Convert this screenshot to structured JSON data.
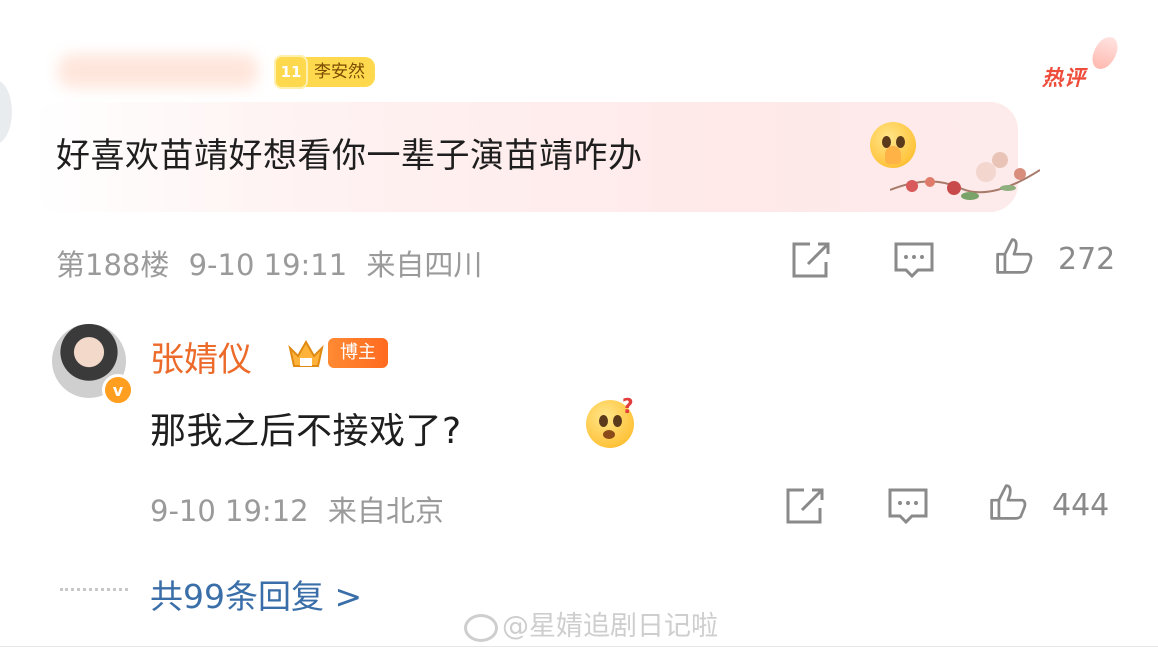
{
  "comment": {
    "fan_level": "11",
    "fan_name": "李安然",
    "hot_label": "热评",
    "text": "好喜欢苗靖好想看你一辈子演苗靖咋办",
    "floor": "第188楼",
    "time": "9-10 19:11",
    "location": "来自四川",
    "likes": "272"
  },
  "reply": {
    "author": "张婧仪",
    "role_badge": "博主",
    "text": "那我之后不接戏了?",
    "time": "9-10 19:12",
    "location": "来自北京",
    "likes": "444"
  },
  "footer": {
    "more_replies": "共99条回复 >",
    "watermark": "@星婧追剧日记啦"
  },
  "colors": {
    "accent_orange": "#ec6a2a",
    "link_blue": "#3a6ea8",
    "hot_red": "#ee4d3a",
    "fan_yellow": "#ffd94d"
  },
  "icons": [
    "verified-icon",
    "crown-icon",
    "share-icon",
    "comment-icon",
    "like-icon"
  ]
}
